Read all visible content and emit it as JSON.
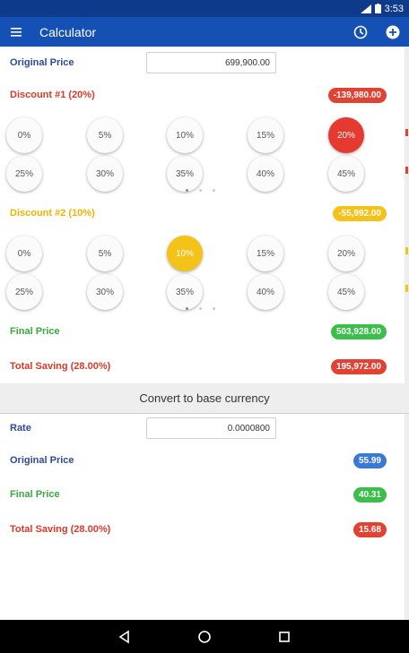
{
  "status": {
    "network": "3G",
    "time": "3:53"
  },
  "app": {
    "title": "Calculator"
  },
  "original_price": {
    "label": "Original Price",
    "value": "699,900.00"
  },
  "discount1": {
    "label": "Discount #1 (20%)",
    "amount": "-139,980.00",
    "options_row1": [
      "0%",
      "5%",
      "10%",
      "15%",
      "20%"
    ],
    "options_row2": [
      "25%",
      "30%",
      "35%",
      "40%",
      "45%"
    ],
    "selected": "20%"
  },
  "discount2": {
    "label": "Discount #2 (10%)",
    "amount": "-55,992.00",
    "options_row1": [
      "0%",
      "5%",
      "10%",
      "15%",
      "20%"
    ],
    "options_row2": [
      "25%",
      "30%",
      "35%",
      "40%",
      "45%"
    ],
    "selected": "10%"
  },
  "final_price": {
    "label": "Final Price",
    "value": "503,928.00"
  },
  "total_saving": {
    "label": "Total Saving (28.00%)",
    "value": "195,972.00"
  },
  "convert": {
    "label": "Convert to base currency"
  },
  "rate": {
    "label": "Rate",
    "value": "0.0000800"
  },
  "base": {
    "original_label": "Original Price",
    "original_value": "55.99",
    "final_label": "Final Price",
    "final_value": "40.31",
    "saving_label": "Total Saving (28.00%)",
    "saving_value": "15.68"
  },
  "colors": {
    "primary": "#1550b5",
    "red": "#e04333",
    "yellow": "#f5c21a",
    "green": "#3bbf4a",
    "blue": "#3979d6"
  },
  "icons": [
    "menu-icon",
    "history-icon",
    "add-icon",
    "back-icon",
    "home-icon",
    "recents-icon"
  ]
}
